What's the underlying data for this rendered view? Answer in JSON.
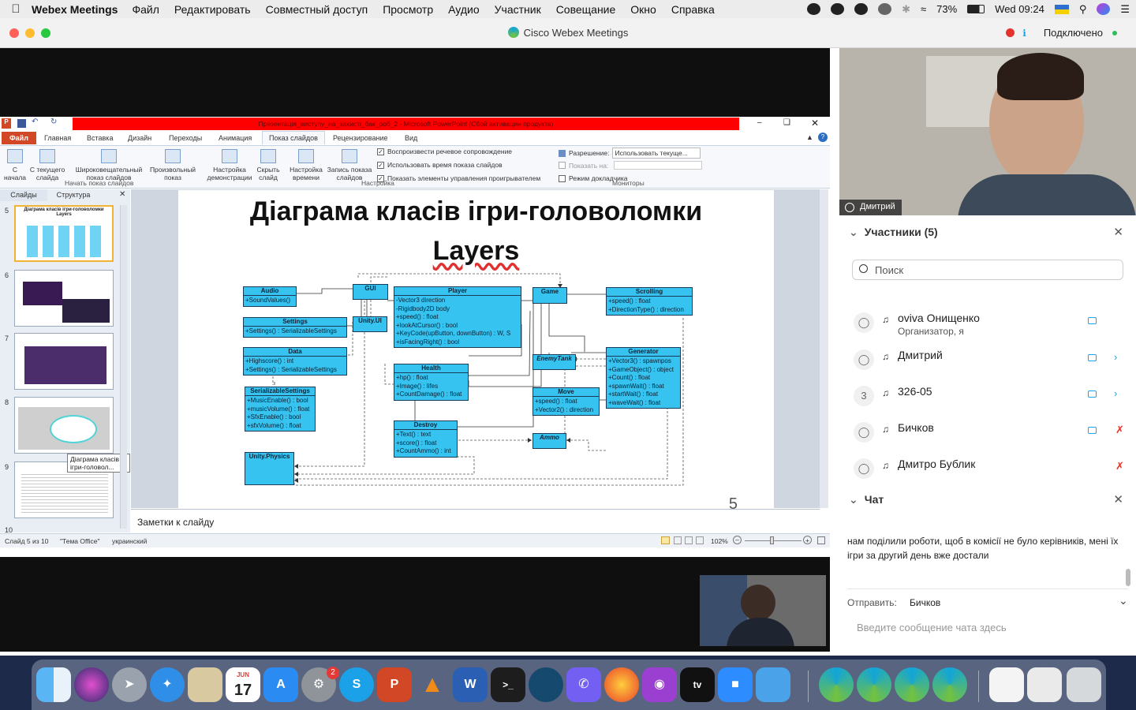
{
  "menubar": {
    "app_name": "Webex Meetings",
    "items": [
      "Файл",
      "Редактировать",
      "Совместный доступ",
      "Просмотр",
      "Аудио",
      "Участник",
      "Совещание",
      "Окно",
      "Справка"
    ],
    "battery": "73%",
    "clock": "Wed 09:24"
  },
  "window": {
    "title": "Cisco Webex Meetings",
    "connection": "Подключено",
    "accent_color": "#1aa4e8"
  },
  "ppt": {
    "title": "Презентація_виступу_на_захисті_бак_роб_2 - Microsoft PowerPoint (Сбой активации продукта)",
    "tabs": [
      "Файл",
      "Главная",
      "Вставка",
      "Дизайн",
      "Переходы",
      "Анимация",
      "Показ слайдов",
      "Рецензирование",
      "Вид"
    ],
    "ribbon": {
      "b1": "С начала",
      "b2": "С текущего слайда",
      "b3": "Широковещательный показ слайдов",
      "b4": "Произвольный показ",
      "b5": "Настройка демонстрации",
      "b6": "Скрыть слайд",
      "b7": "Настройка времени",
      "b8": "Запись показа слайдов",
      "chk1": "Воспроизвести речевое сопровождение",
      "chk2": "Использовать время показа слайдов",
      "chk3": "Показать элементы управления проигрывателем",
      "res_label": "Разрешение:",
      "res_value": "Использовать текуще...",
      "show_on": "Показать на:",
      "presenter": "Режим докладчика",
      "g1": "Начать показ слайдов",
      "g2": "Настройка",
      "g3": "Мониторы"
    },
    "pane_tabs": [
      "Слайды",
      "Структура"
    ],
    "thumbs": [
      "5",
      "6",
      "7",
      "8",
      "9",
      "10"
    ],
    "tooltip": "Діаграма класів ігри-головол...",
    "slide_title_line1": "Діаграма класів ігри-головоломки",
    "slide_title_line2": "Layers",
    "slide_number": "5",
    "notes_placeholder": "Заметки к слайду",
    "status": {
      "slide": "Слайд 5 из 10",
      "theme": "\"Тема Office\"",
      "lang": "украинский",
      "zoom": "102%"
    }
  },
  "uml": {
    "audio": {
      "name": "Audio",
      "members": [
        "+SoundValues()"
      ]
    },
    "gui": {
      "name": "GUI",
      "members": []
    },
    "unity_ui": {
      "name": "Unity.UI",
      "members": []
    },
    "settings": {
      "name": "Settings",
      "members": [
        "+Settings() : SerializableSettings"
      ]
    },
    "data": {
      "name": "Data",
      "members": [
        "+Highscore() : int",
        "+Settings() : SerializableSettings"
      ]
    },
    "serializable": {
      "name": "SerializableSettings",
      "members": [
        "+MusicEnable() : bool",
        "+musicVolume() : float",
        "+SfxEnable() : bool",
        "+sfxVolume() : float"
      ]
    },
    "unity_physics": {
      "name": "Unity.Physics",
      "members": []
    },
    "player": {
      "name": "Player",
      "members": [
        "-Vector3 direction",
        "-Rigidbody2D body",
        "+speed() : float",
        "+lookAtCursor() : bool",
        "+KeyCode(upButton, downButton) : W, S",
        "+isFacingRight() : bool"
      ]
    },
    "health": {
      "name": "Health",
      "members": [
        "+hp() : float",
        "+Image() : lifes",
        "+CountDamage() : float"
      ]
    },
    "destroy": {
      "name": "Destroy",
      "members": [
        "+Text() : text",
        "+score() : float",
        "+CountAmmo() : int"
      ]
    },
    "game": {
      "name": "Game",
      "members": []
    },
    "enemytank": {
      "name": "EnemyTank",
      "members": []
    },
    "move": {
      "name": "Move",
      "members": [
        "+speed() : float",
        "+Vector2() : direction"
      ]
    },
    "ammo": {
      "name": "Ammo",
      "members": []
    },
    "scrolling": {
      "name": "Scrolling",
      "members": [
        "+speed() : float",
        "+DirectionType() : direction"
      ]
    },
    "generator": {
      "name": "Generator",
      "members": [
        "+Vector3() : spawnpos",
        "+GameObject() : object",
        "+Count() : float",
        "+spawnWait() : float",
        "+startWait() : float",
        "+waveWait() : float"
      ]
    }
  },
  "video": {
    "main_name": "Дмитрий"
  },
  "participants": {
    "header": "Участники (5)",
    "search_placeholder": "Поиск",
    "list": [
      {
        "name": "oviva Онищенко",
        "role": "Организатор, я",
        "avatar": ""
      },
      {
        "name": "Дмитрий",
        "role": "",
        "avatar": ""
      },
      {
        "name": "326-05",
        "role": "",
        "avatar": "3"
      },
      {
        "name": "Бичков",
        "role": "",
        "avatar": ""
      },
      {
        "name": "Дмитро Бублик",
        "role": "",
        "avatar": ""
      }
    ]
  },
  "chat": {
    "header": "Чат",
    "last_message": "нам поділили роботи, щоб в комісії не було керівників, мені їх ігри за другий день вже достали",
    "send_label": "Отправить:",
    "send_to": "Бичков",
    "input_placeholder": "Введите сообщение чата здесь"
  },
  "dock": {
    "apps": [
      "finder-icon",
      "siri-icon",
      "launchpad-icon",
      "safari-icon",
      "preview-icon",
      "calendar-icon",
      "app-store-icon",
      "system-preferences-icon",
      "skype-icon",
      "powerpoint-icon",
      "vlc-icon",
      "word-icon",
      "terminal-icon",
      "webex-teams-icon",
      "viber-icon",
      "firefox-icon",
      "podcasts-icon",
      "apple-tv-icon",
      "zoom-icon",
      "files-icon",
      "webex-icon",
      "webex-icon",
      "webex-icon",
      "webex-icon",
      "documents-icon",
      "trash-icon"
    ],
    "calendar_month": "JUN",
    "calendar_day": "17",
    "prefs_badge": "2"
  }
}
